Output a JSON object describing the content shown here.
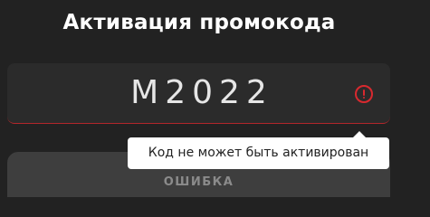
{
  "title": "Активация промокода",
  "promo": {
    "value": "M2022"
  },
  "tooltip": {
    "text": "Код не может быть активирован"
  },
  "button": {
    "label": "ОШИБКА"
  },
  "icons": {
    "error": "exclamation-circle-icon"
  },
  "colors": {
    "background": "#222222",
    "field": "#2b2b2b",
    "error": "#d8292f",
    "tooltip": "#ffffff",
    "button": "#3e3e3e",
    "button_text": "#8b8b8b"
  }
}
